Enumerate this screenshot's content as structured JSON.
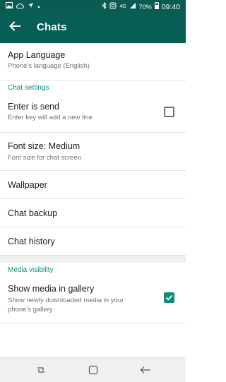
{
  "status_bar": {
    "battery": "70%",
    "time": "09:40",
    "network": "4G",
    "left_icons": [
      "image-icon",
      "cloud-icon",
      "location-icon",
      "dot-icon"
    ],
    "right_icons": [
      "bluetooth-icon",
      "alarm-icon",
      "signal-icon",
      "battery-icon"
    ]
  },
  "app_bar": {
    "title": "Chats",
    "back_icon": "arrow-left-icon",
    "color": "#075e54"
  },
  "settings": {
    "app_language": {
      "title": "App Language",
      "subtitle": "Phone's language (English)"
    },
    "chat_settings_header": "Chat settings",
    "enter_is_send": {
      "title": "Enter is send",
      "subtitle": "Enter key will add a new line",
      "checked": false
    },
    "font_size": {
      "title": "Font size: Medium",
      "subtitle": "Font size for chat screen"
    },
    "wallpaper": {
      "title": "Wallpaper"
    },
    "chat_backup": {
      "title": "Chat backup"
    },
    "chat_history": {
      "title": "Chat history"
    },
    "media_visibility_header": "Media visibility",
    "show_media": {
      "title": "Show media in gallery",
      "subtitle_line1": "Show newly downloaded media in your",
      "subtitle_line2": "phone's gallery",
      "checked": true
    }
  },
  "accent_color": "#0e8e7a",
  "nav_bar": {
    "icons": [
      "recent-apps-icon",
      "home-icon",
      "back-icon"
    ]
  }
}
